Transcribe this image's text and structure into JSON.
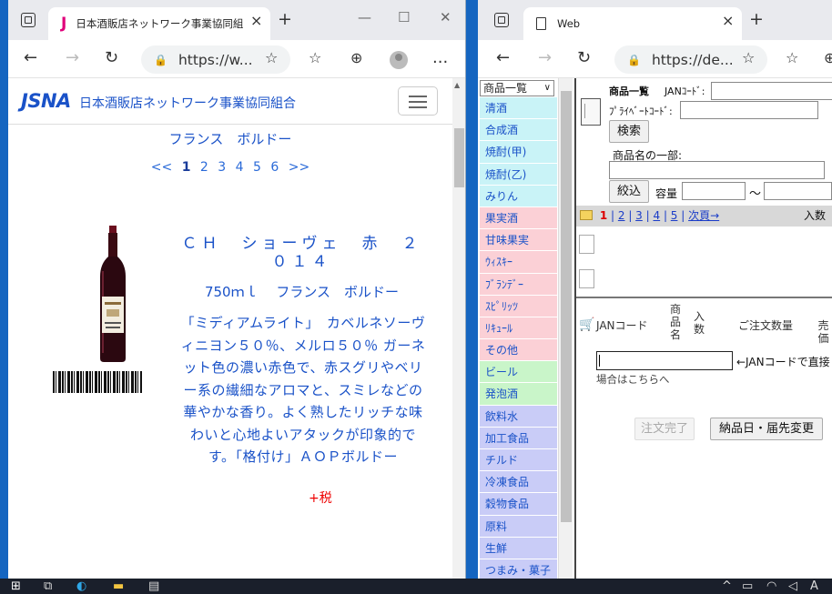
{
  "left_browser": {
    "tab_title": "日本酒販店ネットワーク事業協同組",
    "tab_close": "×",
    "new_tab": "+",
    "window_controls": {
      "minimize": "—",
      "maximize": "☐",
      "close": "✕"
    },
    "address": "https://w...",
    "more_menu": "..."
  },
  "left_page": {
    "logo": "JSNA",
    "org_name": "日本酒販店ネットワーク事業協同組合",
    "region_top": "フランス　ボルドー",
    "pager": {
      "prev": "<<",
      "current": "1",
      "pages": [
        "2",
        "3",
        "4",
        "5",
        "6"
      ],
      "next": ">>"
    },
    "product": {
      "name": "ＣＨ　ショーヴェ　赤　２０１４",
      "spec": "750ｍｌ　 フランス　ボルドー",
      "description": "「ミディアムライト」　カベルネソーヴィニヨン５０％、メルロ５０％ ガーネット色の濃い赤色で、赤スグリやベリー系の繊細なアロマと、スミレなどの華やかな香り。よく熟したリッチな味わいと心地よいアタックが印象的です。「格付け」ＡＯＰボルドー",
      "tax_note": "+税"
    }
  },
  "right_browser": {
    "tab_title": "Web",
    "tab_close": "×",
    "new_tab": "+",
    "address": "https://de..."
  },
  "right_page": {
    "category_select": "商品一覧",
    "categories": [
      {
        "label": "清酒",
        "color": "cyan"
      },
      {
        "label": "合成酒",
        "color": "cyan"
      },
      {
        "label": "焼酎(甲)",
        "color": "cyan"
      },
      {
        "label": "焼酎(乙)",
        "color": "cyan"
      },
      {
        "label": "みりん",
        "color": "cyan"
      },
      {
        "label": "果実酒",
        "color": "pink"
      },
      {
        "label": "甘味果実",
        "color": "pink"
      },
      {
        "label": "ｳｨｽｷｰ",
        "color": "pink"
      },
      {
        "label": "ﾌﾞﾗﾝﾃﾞｰ",
        "color": "pink"
      },
      {
        "label": "ｽﾋﾟﾘｯﾂ",
        "color": "pink"
      },
      {
        "label": "ﾘｷｭｰﾙ",
        "color": "pink"
      },
      {
        "label": "その他",
        "color": "pink"
      },
      {
        "label": "ビール",
        "color": "green"
      },
      {
        "label": "発泡酒",
        "color": "green"
      },
      {
        "label": "飲料水",
        "color": "lavender"
      },
      {
        "label": "加工食品",
        "color": "lavender"
      },
      {
        "label": "チルド",
        "color": "lavender"
      },
      {
        "label": "冷凍食品",
        "color": "lavender"
      },
      {
        "label": "穀物食品",
        "color": "lavender"
      },
      {
        "label": "原料",
        "color": "lavender"
      },
      {
        "label": "生鮮",
        "color": "lavender"
      },
      {
        "label": "つまみ・菓子",
        "color": "lavender"
      }
    ],
    "form": {
      "title": "商品一覧",
      "jan_label": "JANｺｰﾄﾞ:",
      "private_label": "ﾌﾟﾗｲﾍﾞｰﾄｺｰﾄﾞ:",
      "search_button": "検索",
      "name_part_label": "商品名の一部:",
      "narrow_button": "絞込",
      "volume_label": "容量",
      "range_sep": "〜"
    },
    "pagination": {
      "current": "1",
      "pages": [
        "2",
        "3",
        "4",
        "5"
      ],
      "next": "次頁→",
      "right_label": "入数"
    },
    "order_header": {
      "jan_code": "JANコード",
      "product_name": "商品名",
      "qty_per_case": "入数",
      "order_qty": "ご注文数量",
      "sale": "売価"
    },
    "jan_hint": "←JANコードで直接",
    "jan_hint2": "場合はこちらへ",
    "order_complete_button": "注文完了",
    "date_change_button": "納品日・届先変更"
  },
  "taskbar": {
    "right_text": "A"
  }
}
